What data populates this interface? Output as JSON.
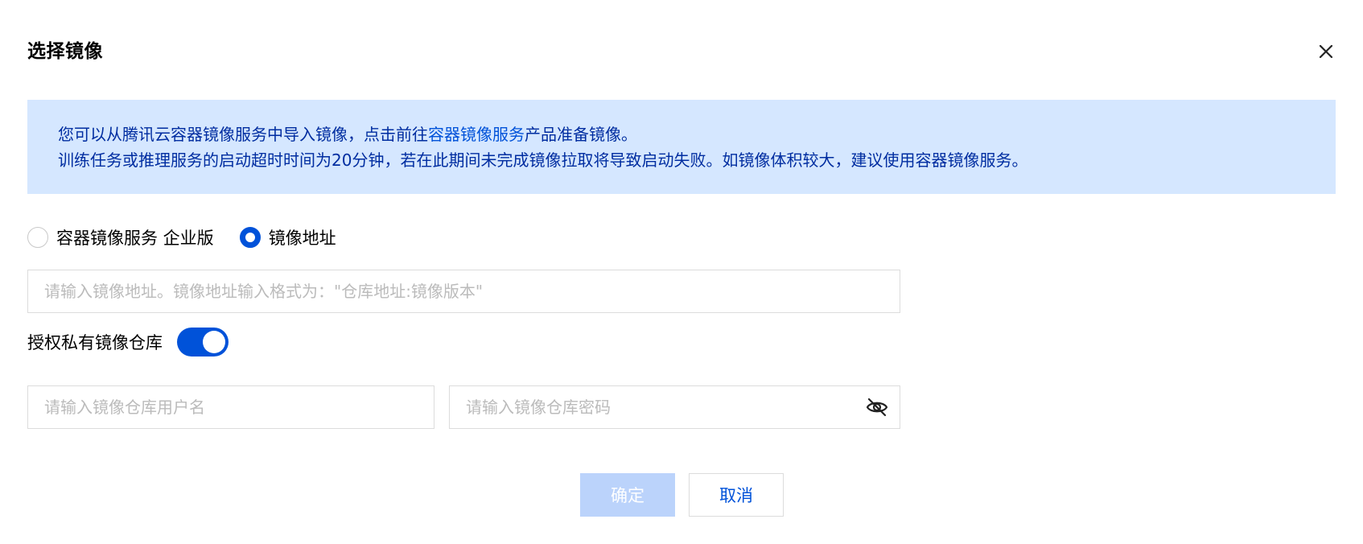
{
  "dialog": {
    "title": "选择镜像",
    "close_icon": "close-icon"
  },
  "notice": {
    "line1_before": "您可以从腾讯云容器镜像服务中导入镜像，点击前往",
    "line1_link": "容器镜像服务",
    "line1_after": "产品准备镜像。",
    "line2": "训练任务或推理服务的启动超时时间为20分钟，若在此期间未完成镜像拉取将导致启动失败。如镜像体积较大，建议使用容器镜像服务。"
  },
  "source_options": [
    {
      "label": "容器镜像服务 企业版",
      "checked": false
    },
    {
      "label": "镜像地址",
      "checked": true
    }
  ],
  "image_url": {
    "value": "",
    "placeholder": "请输入镜像地址。镜像地址输入格式为：\"仓库地址:镜像版本\""
  },
  "private_registry": {
    "label": "授权私有镜像仓库",
    "enabled": true
  },
  "username": {
    "value": "",
    "placeholder": "请输入镜像仓库用户名"
  },
  "password": {
    "value": "",
    "placeholder": "请输入镜像仓库密码",
    "visibility_icon": "eye-off-icon"
  },
  "actions": {
    "confirm_label": "确定",
    "cancel_label": "取消"
  },
  "colors": {
    "primary": "#0052d9",
    "notice_bg": "#d5e7ff",
    "notice_text": "#002da0",
    "confirm_disabled": "#bbd3fb"
  }
}
